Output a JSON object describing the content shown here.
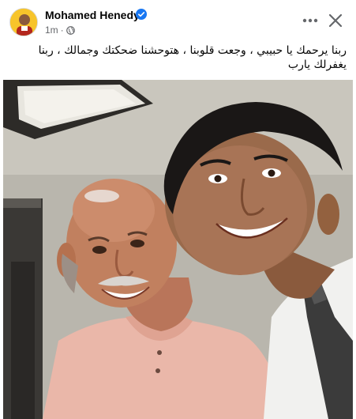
{
  "post": {
    "author": "Mohamed Henedy",
    "time": "1m",
    "separator": "·",
    "audience_icon": "globe-icon",
    "verified_icon": "verified-badge-icon",
    "text": "ربنا يرحمك يا حبيبي ، وجعت قلوبنا ، هتوحشنا ضحكتك وجمالك ، ربنا يغفرلك يارب",
    "accent_color": "#1877f2"
  },
  "actions": {
    "more_icon": "more-options-icon",
    "close_icon": "close-icon"
  },
  "photo": {
    "subject": "photo-selfie-two-men"
  }
}
